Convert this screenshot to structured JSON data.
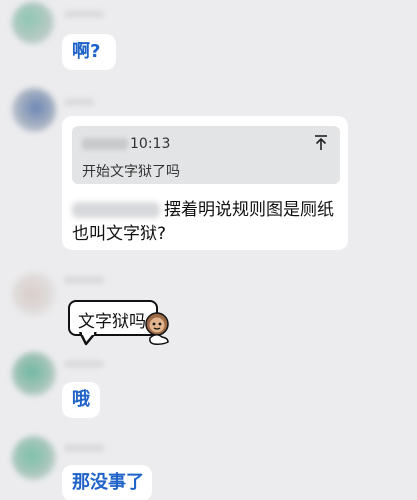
{
  "messages": [
    {
      "text": "啊?"
    },
    {
      "quote": {
        "time": "10:13",
        "text": "开始文字狱了吗"
      },
      "reply": "摆着明说规则图是厕纸也叫文字狱?"
    },
    {
      "sticker_text": "文字狱吗"
    },
    {
      "text": "哦"
    },
    {
      "text": "那没事了"
    }
  ],
  "colors": {
    "background": "#ececee",
    "bubble": "#ffffff",
    "short_text": "#1f63c9",
    "quote_background": "#e3e4e6"
  },
  "icons": [
    "pin-to-top-icon",
    "sticker-face-icon"
  ]
}
